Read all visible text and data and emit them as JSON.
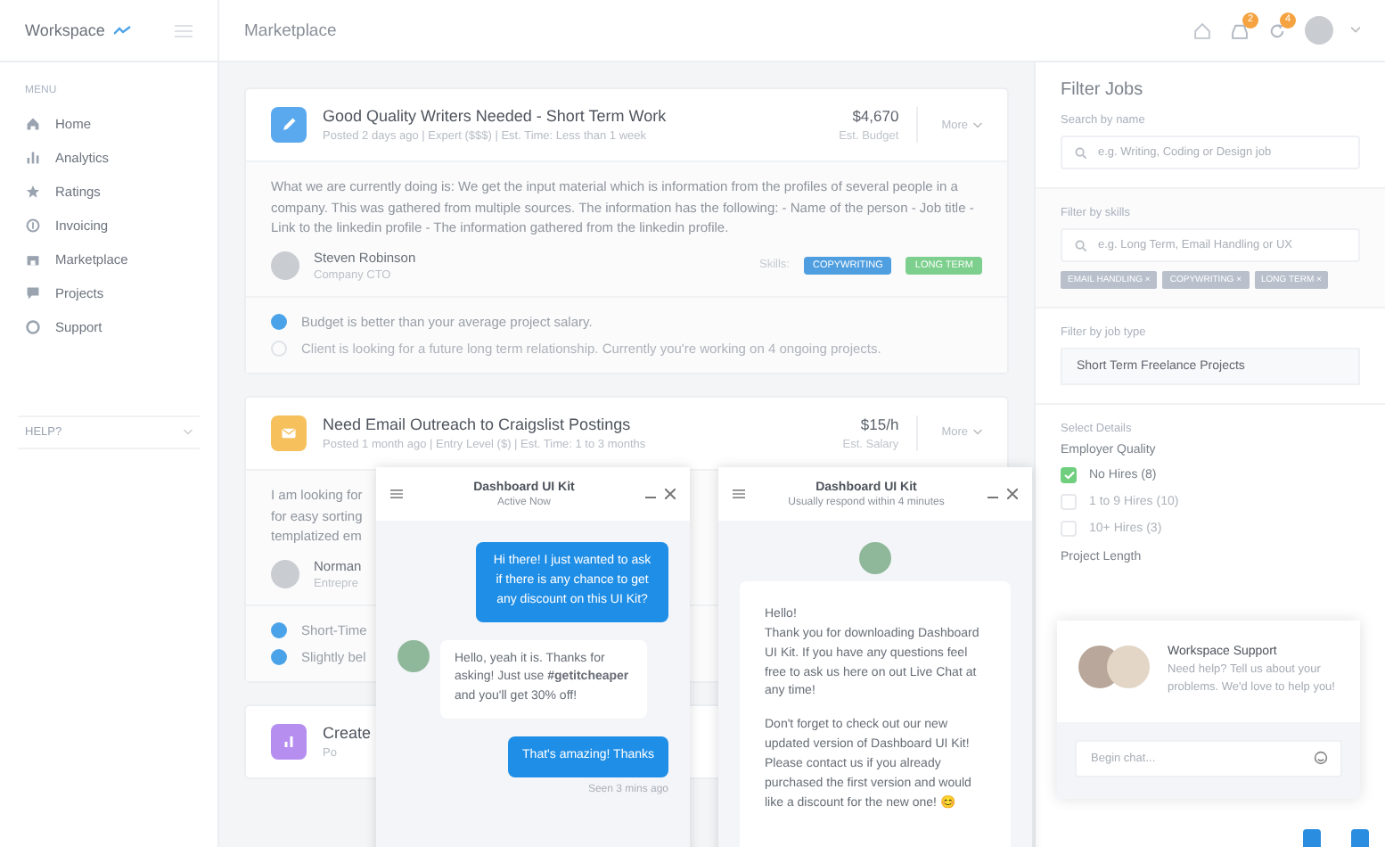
{
  "sidebar": {
    "brand": "Workspace",
    "menu_label": "MENU",
    "items": [
      {
        "label": "Home"
      },
      {
        "label": "Analytics"
      },
      {
        "label": "Ratings"
      },
      {
        "label": "Invoicing"
      },
      {
        "label": "Marketplace"
      },
      {
        "label": "Projects"
      },
      {
        "label": "Support"
      }
    ],
    "groups": [
      {
        "label": "HELP?"
      }
    ]
  },
  "header": {
    "title": "Marketplace",
    "badges": [
      {
        "count": "2"
      },
      {
        "count": "4"
      }
    ]
  },
  "jobs": [
    {
      "color": "#5aa9ee",
      "title": "Good Quality Writers Needed - Short Term Work",
      "meta": "Posted 2 days ago  |  Expert ($$$)  |  Est. Time: Less than 1 week",
      "price": "$4,670",
      "price_label": "Est. Budget",
      "more": "More",
      "description_lines": [
        "What we are currently doing is: We get the input material which is information from the profiles of several people in a company. This was gathered from multiple sources. The information has the following: - Name of the person - Job title - Link to the linkedin profile - The information gathered from the linkedin profile."
      ],
      "author": {
        "name": "Steven Robinson",
        "role": "Company CTO"
      },
      "skills_label": "Skills:",
      "skills": [
        {
          "label": "COPYWRITING",
          "color": "#4f9ee0"
        },
        {
          "label": "LONG TERM",
          "color": "#7ccf8c"
        }
      ],
      "checks": [
        {
          "label": "Budget is better than your average project salary.",
          "checked": true
        },
        {
          "label": "Client is looking for a future long term relationship. Currently you're working on 4 ongoing projects.",
          "checked": false
        }
      ]
    },
    {
      "color": "#f6c05c",
      "title": "Need Email Outreach to Craigslist Postings",
      "meta": "Posted 1 month ago  |  Entry Level ($)  |  Est. Time: 1 to 3 months",
      "price": "$15/h",
      "price_label": "Est. Salary",
      "more": "More",
      "description_lines": [
        "I am looking for",
        "for easy sorting",
        "templatized em"
      ],
      "author": {
        "name": "Norman",
        "role": "Entrepre"
      },
      "checks": [
        {
          "label": "Short-Time",
          "checked": true
        },
        {
          "label": "Slightly bel",
          "checked": true
        }
      ]
    },
    {
      "color": "#b68ef0",
      "title": "Create",
      "meta": "Po"
    }
  ],
  "chats": [
    {
      "title": "Dashboard UI Kit",
      "subtitle": "Active Now",
      "messages": [
        {
          "kind": "out",
          "text": "Hi there! I just wanted to ask if there is any chance to get any discount on this UI Kit?"
        },
        {
          "kind": "in",
          "text": "Hello, yeah it is. Thanks for asking! Just use **#getitcheaper** and you'll get 30% off!"
        },
        {
          "kind": "out",
          "text": "That's amazing! Thanks"
        },
        {
          "kind": "status",
          "text": "Seen 3 mins ago"
        }
      ]
    },
    {
      "title": "Dashboard UI Kit",
      "subtitle": "Usually respond within 4 minutes",
      "messages": [
        {
          "kind": "card",
          "paragraphs": [
            "Hello!\nThank you for downloading Dashboard UI Kit. If you have any questions feel free to ask us here on out Live Chat at any time!",
            "Don't forget to check out our new updated version of Dashboard UI Kit! Please contact us if you already purchased the first version and would like a discount for the new one! 😊"
          ]
        }
      ]
    }
  ],
  "filters": {
    "title": "Filter Jobs",
    "search_label": "Search by name",
    "search_placeholder": "e.g. Writing, Coding or Design job",
    "skills_label": "Filter by skills",
    "skills_placeholder": "e.g. Long Term, Email Handling or UX",
    "tags": [
      "EMAIL HANDLING ×",
      "COPYWRITING ×",
      "LONG TERM ×"
    ],
    "type_label": "Filter by job type",
    "type_value": "Short Term Freelance Projects",
    "details_label": "Select Details",
    "quality_label": "Employer Quality",
    "quality": [
      {
        "label": "No Hires (8)",
        "checked": true
      },
      {
        "label": "1 to 9 Hires (10)",
        "checked": false
      },
      {
        "label": "10+ Hires (3)",
        "checked": false
      }
    ],
    "length_label": "Project Length"
  },
  "support": {
    "title": "Workspace Support",
    "text": "Need help? Tell us about your problems. We'd love to help you!",
    "placeholder": "Begin chat..."
  }
}
